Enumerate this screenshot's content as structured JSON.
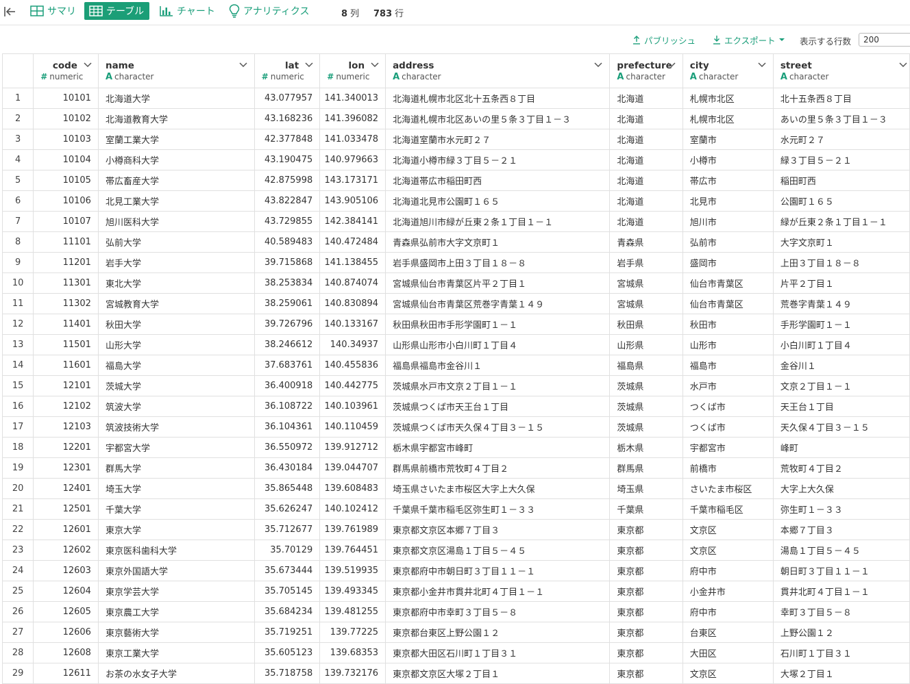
{
  "tabs": [
    {
      "label": "サマリ",
      "icon": "summary-grid-icon",
      "active": false
    },
    {
      "label": "テーブル",
      "icon": "table-icon",
      "active": true
    },
    {
      "label": "チャート",
      "icon": "chart-icon",
      "active": false
    },
    {
      "label": "アナリティクス",
      "icon": "lightbulb-icon",
      "active": false
    }
  ],
  "meta": {
    "cols_count": "8",
    "cols_unit": "列",
    "rows_count": "783",
    "rows_unit": "行"
  },
  "toolbar": {
    "publish": "パブリッシュ",
    "export": "エクスポート",
    "rows_label": "表示する行数",
    "rows_value": "200"
  },
  "colors": {
    "accent": "#1b9e77",
    "accent_text": "#1a9e7a",
    "border": "#e0e0e0"
  },
  "columns": [
    {
      "name": "code",
      "type": "numeric",
      "type_symbol": "#"
    },
    {
      "name": "name",
      "type": "character",
      "type_symbol": "A"
    },
    {
      "name": "lat",
      "type": "numeric",
      "type_symbol": "#"
    },
    {
      "name": "lon",
      "type": "numeric",
      "type_symbol": "#"
    },
    {
      "name": "address",
      "type": "character",
      "type_symbol": "A"
    },
    {
      "name": "prefecture",
      "type": "character",
      "type_symbol": "A"
    },
    {
      "name": "city",
      "type": "character",
      "type_symbol": "A"
    },
    {
      "name": "street",
      "type": "character",
      "type_symbol": "A"
    }
  ],
  "rows": [
    [
      "1",
      "10101",
      "北海道大学",
      "43.077957",
      "141.340013",
      "北海道札幌市北区北十五条西８丁目",
      "北海道",
      "札幌市北区",
      "北十五条西８丁目"
    ],
    [
      "2",
      "10102",
      "北海道教育大学",
      "43.168236",
      "141.396082",
      "北海道札幌市北区あいの里５条３丁目１－３",
      "北海道",
      "札幌市北区",
      "あいの里５条３丁目１－３"
    ],
    [
      "3",
      "10103",
      "室蘭工業大学",
      "42.377848",
      "141.033478",
      "北海道室蘭市水元町２７",
      "北海道",
      "室蘭市",
      "水元町２７"
    ],
    [
      "4",
      "10104",
      "小樽商科大学",
      "43.190475",
      "140.979663",
      "北海道小樽市緑３丁目５－２１",
      "北海道",
      "小樽市",
      "緑３丁目５－２１"
    ],
    [
      "5",
      "10105",
      "帯広畜産大学",
      "42.875998",
      "143.173171",
      "北海道帯広市稲田町西",
      "北海道",
      "帯広市",
      "稲田町西"
    ],
    [
      "6",
      "10106",
      "北見工業大学",
      "43.822847",
      "143.905106",
      "北海道北見市公園町１６５",
      "北海道",
      "北見市",
      "公園町１６５"
    ],
    [
      "7",
      "10107",
      "旭川医科大学",
      "43.729855",
      "142.384141",
      "北海道旭川市緑が丘東２条１丁目１－１",
      "北海道",
      "旭川市",
      "緑が丘東２条１丁目１－１"
    ],
    [
      "8",
      "11101",
      "弘前大学",
      "40.589483",
      "140.472484",
      "青森県弘前市大字文京町１",
      "青森県",
      "弘前市",
      "大字文京町１"
    ],
    [
      "9",
      "11201",
      "岩手大学",
      "39.715868",
      "141.138455",
      "岩手県盛岡市上田３丁目１８－８",
      "岩手県",
      "盛岡市",
      "上田３丁目１８－８"
    ],
    [
      "10",
      "11301",
      "東北大学",
      "38.253834",
      "140.874074",
      "宮城県仙台市青葉区片平２丁目１",
      "宮城県",
      "仙台市青葉区",
      "片平２丁目１"
    ],
    [
      "11",
      "11302",
      "宮城教育大学",
      "38.259061",
      "140.830894",
      "宮城県仙台市青葉区荒巻字青葉１４９",
      "宮城県",
      "仙台市青葉区",
      "荒巻字青葉１４９"
    ],
    [
      "12",
      "11401",
      "秋田大学",
      "39.726796",
      "140.133167",
      "秋田県秋田市手形学園町１－１",
      "秋田県",
      "秋田市",
      "手形学園町１－１"
    ],
    [
      "13",
      "11501",
      "山形大学",
      "38.246612",
      "140.34937",
      "山形県山形市小白川町１丁目４",
      "山形県",
      "山形市",
      "小白川町１丁目４"
    ],
    [
      "14",
      "11601",
      "福島大学",
      "37.683761",
      "140.455836",
      "福島県福島市金谷川１",
      "福島県",
      "福島市",
      "金谷川１"
    ],
    [
      "15",
      "12101",
      "茨城大学",
      "36.400918",
      "140.442775",
      "茨城県水戸市文京２丁目１－１",
      "茨城県",
      "水戸市",
      "文京２丁目１－１"
    ],
    [
      "16",
      "12102",
      "筑波大学",
      "36.108722",
      "140.103961",
      "茨城県つくば市天王台１丁目",
      "茨城県",
      "つくば市",
      "天王台１丁目"
    ],
    [
      "17",
      "12103",
      "筑波技術大学",
      "36.104361",
      "140.110459",
      "茨城県つくば市天久保４丁目３－１５",
      "茨城県",
      "つくば市",
      "天久保４丁目３－１５"
    ],
    [
      "18",
      "12201",
      "宇都宮大学",
      "36.550972",
      "139.912712",
      "栃木県宇都宮市峰町",
      "栃木県",
      "宇都宮市",
      "峰町"
    ],
    [
      "19",
      "12301",
      "群馬大学",
      "36.430184",
      "139.044707",
      "群馬県前橋市荒牧町４丁目２",
      "群馬県",
      "前橋市",
      "荒牧町４丁目２"
    ],
    [
      "20",
      "12401",
      "埼玉大学",
      "35.865448",
      "139.608483",
      "埼玉県さいたま市桜区大字上大久保",
      "埼玉県",
      "さいたま市桜区",
      "大字上大久保"
    ],
    [
      "21",
      "12501",
      "千葉大学",
      "35.626247",
      "140.102412",
      "千葉県千葉市稲毛区弥生町１－３３",
      "千葉県",
      "千葉市稲毛区",
      "弥生町１－３３"
    ],
    [
      "22",
      "12601",
      "東京大学",
      "35.712677",
      "139.761989",
      "東京都文京区本郷７丁目３",
      "東京都",
      "文京区",
      "本郷７丁目３"
    ],
    [
      "23",
      "12602",
      "東京医科歯科大学",
      "35.70129",
      "139.764451",
      "東京都文京区湯島１丁目５－４５",
      "東京都",
      "文京区",
      "湯島１丁目５－４５"
    ],
    [
      "24",
      "12603",
      "東京外国語大学",
      "35.673444",
      "139.519935",
      "東京都府中市朝日町３丁目１１－１",
      "東京都",
      "府中市",
      "朝日町３丁目１１－１"
    ],
    [
      "25",
      "12604",
      "東京学芸大学",
      "35.705145",
      "139.493345",
      "東京都小金井市貫井北町４丁目１－１",
      "東京都",
      "小金井市",
      "貫井北町４丁目１－１"
    ],
    [
      "26",
      "12605",
      "東京農工大学",
      "35.684234",
      "139.481255",
      "東京都府中市幸町３丁目５－８",
      "東京都",
      "府中市",
      "幸町３丁目５－８"
    ],
    [
      "27",
      "12606",
      "東京藝術大学",
      "35.719251",
      "139.77225",
      "東京都台東区上野公園１２",
      "東京都",
      "台東区",
      "上野公園１２"
    ],
    [
      "28",
      "12608",
      "東京工業大学",
      "35.605123",
      "139.68353",
      "東京都大田区石川町１丁目３１",
      "東京都",
      "大田区",
      "石川町１丁目３１"
    ],
    [
      "29",
      "12611",
      "お茶の水女子大学",
      "35.718758",
      "139.732176",
      "東京都文京区大塚２丁目１",
      "東京都",
      "文京区",
      "大塚２丁目１"
    ]
  ]
}
